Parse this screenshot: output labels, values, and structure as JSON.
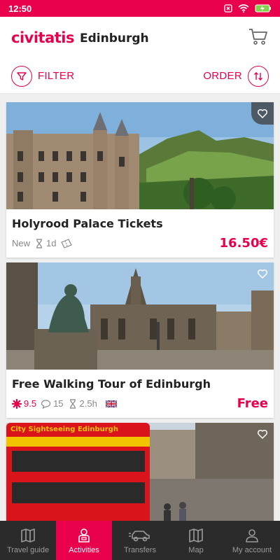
{
  "status_bar": {
    "time": "12:50"
  },
  "header": {
    "brand": "civitatis",
    "city": "Edinburgh"
  },
  "toolbar": {
    "filter_label": "FILTER",
    "order_label": "ORDER"
  },
  "cards": [
    {
      "title": "Holyrood Palace Tickets",
      "badge": "New",
      "duration": "1d",
      "price": "16.50€"
    },
    {
      "title": "Free Walking Tour of Edinburgh",
      "rating": "9.5",
      "reviews": "15",
      "duration": "2.5h",
      "price": "Free"
    },
    {
      "sign_text": "City Sightseeing Edinburgh"
    }
  ],
  "bottom_nav": [
    {
      "label": "Travel guide",
      "icon": "map-book-icon"
    },
    {
      "label": "Activities",
      "icon": "person-icon"
    },
    {
      "label": "Transfers",
      "icon": "car-icon"
    },
    {
      "label": "Map",
      "icon": "map-icon"
    },
    {
      "label": "My account",
      "icon": "user-icon"
    }
  ],
  "colors": {
    "brand": "#e8004d",
    "nav_bg": "#2b2b2b"
  }
}
